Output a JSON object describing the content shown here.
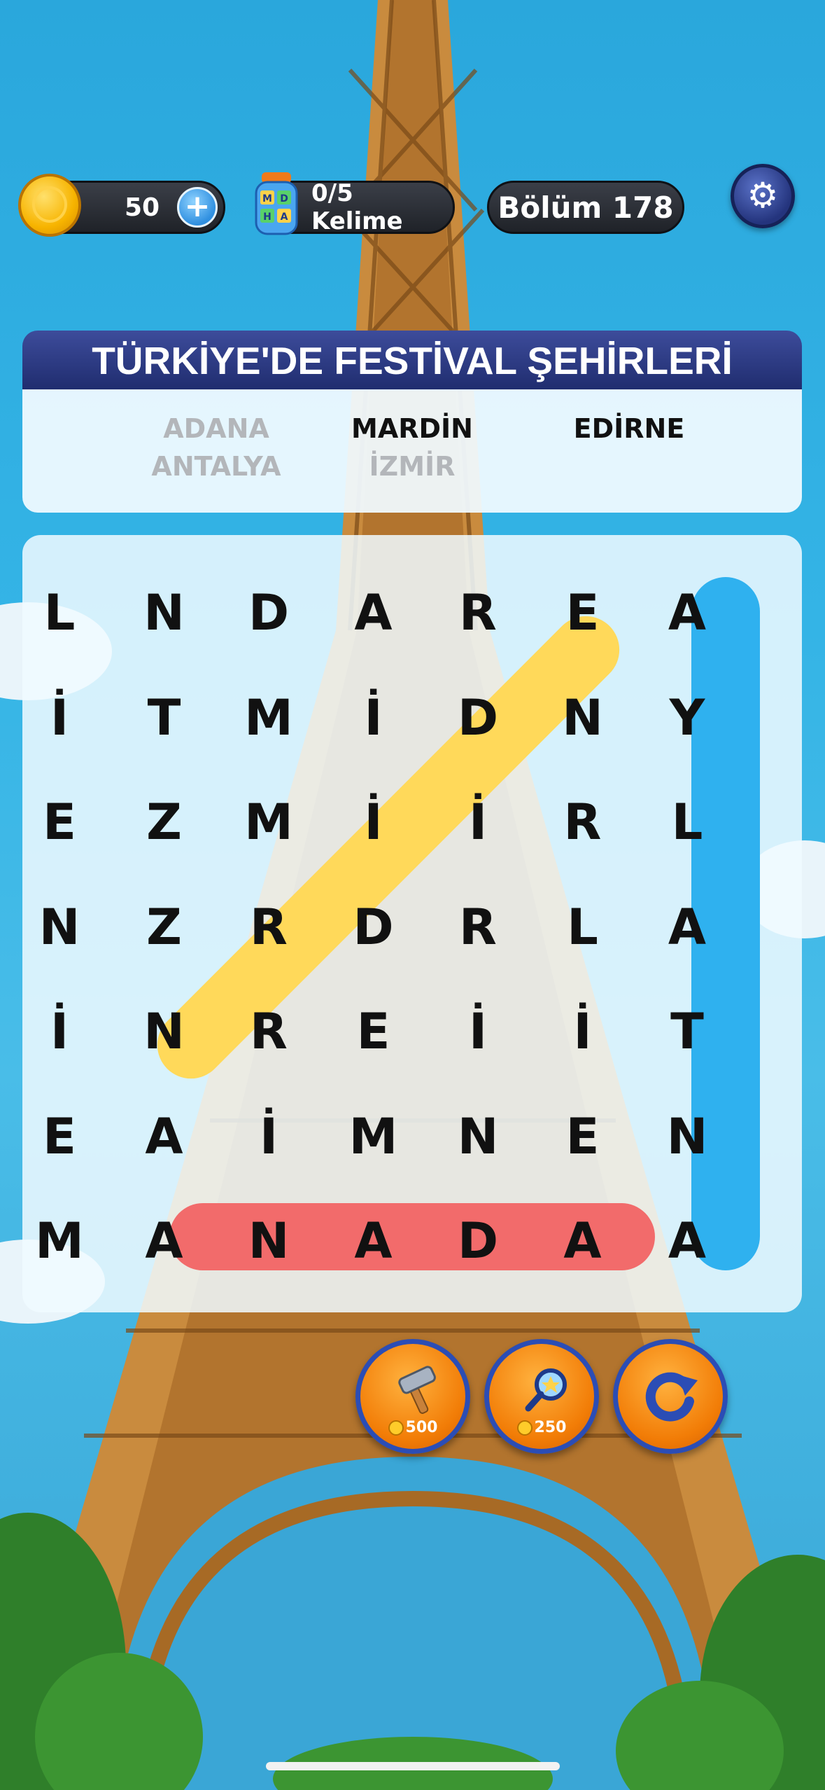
{
  "hud": {
    "coins": "50",
    "plus_label": "+",
    "words_progress": "0/5 Kelime",
    "jar_letters": [
      "M",
      "D",
      "H",
      "A"
    ],
    "level": "Bölüm 178",
    "gear_glyph": "⚙"
  },
  "category_title": "TÜRKİYE'DE FESTİVAL ŞEHİRLERİ",
  "word_list": [
    {
      "text": "ADANA",
      "found": true
    },
    {
      "text": "MARDİN",
      "found": false
    },
    {
      "text": "EDİRNE",
      "found": false
    },
    {
      "text": "ANTALYA",
      "found": true
    },
    {
      "text": "İZMİR",
      "found": true
    }
  ],
  "grid": [
    [
      "L",
      "N",
      "D",
      "A",
      "R",
      "E",
      "A"
    ],
    [
      "İ",
      "T",
      "M",
      "İ",
      "D",
      "N",
      "Y"
    ],
    [
      "E",
      "Z",
      "M",
      "İ",
      "İ",
      "R",
      "L"
    ],
    [
      "N",
      "Z",
      "R",
      "D",
      "R",
      "L",
      "A"
    ],
    [
      "İ",
      "N",
      "R",
      "E",
      "İ",
      "İ",
      "T"
    ],
    [
      "E",
      "A",
      "İ",
      "M",
      "N",
      "E",
      "N"
    ],
    [
      "M",
      "A",
      "N",
      "A",
      "D",
      "A",
      "A"
    ]
  ],
  "found_words_highlights": [
    {
      "word": "İZMİR",
      "color": "#ffd95a"
    },
    {
      "word": "ANTALYA",
      "color": "#2fb1ef"
    },
    {
      "word": "ADANA",
      "color": "#f26b6b"
    }
  ],
  "powerups": [
    {
      "name": "hammer",
      "cost": "500"
    },
    {
      "name": "magnifier",
      "cost": "250"
    },
    {
      "name": "shuffle",
      "cost": ""
    }
  ],
  "colors": {
    "title_bar": "#2a3886",
    "powerup_orange": "#f27d07",
    "powerup_border": "#2b4db5"
  }
}
